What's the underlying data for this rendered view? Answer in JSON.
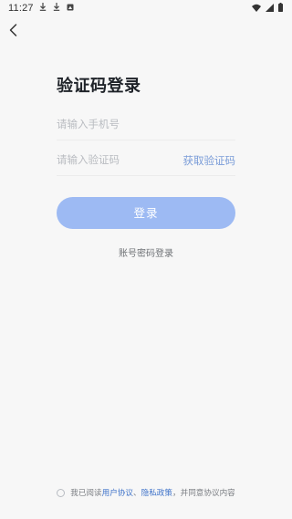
{
  "status_bar": {
    "time": "11:27",
    "icons_left": [
      "download-icon",
      "download-icon",
      "image-icon"
    ],
    "icons_right": [
      "wifi-icon",
      "signal-icon",
      "battery-icon"
    ]
  },
  "page": {
    "title": "验证码登录",
    "back_icon": "back-arrow-icon"
  },
  "form": {
    "phone": {
      "value": "",
      "placeholder": "请输入手机号"
    },
    "code": {
      "value": "",
      "placeholder": "请输入验证码"
    },
    "get_code_label": "获取验证码",
    "login_label": "登录",
    "password_login_label": "账号密码登录"
  },
  "agreement": {
    "prefix": "我已阅读",
    "user_agreement": "用户协议",
    "separator": "、",
    "privacy_policy": "隐私政策",
    "suffix": "，并同意协议内容",
    "checked": false
  },
  "colors": {
    "background": "#f7f7f7",
    "login_button": "#9dbaf3",
    "link": "#3f73c9",
    "get_code": "#7a9cd8"
  }
}
